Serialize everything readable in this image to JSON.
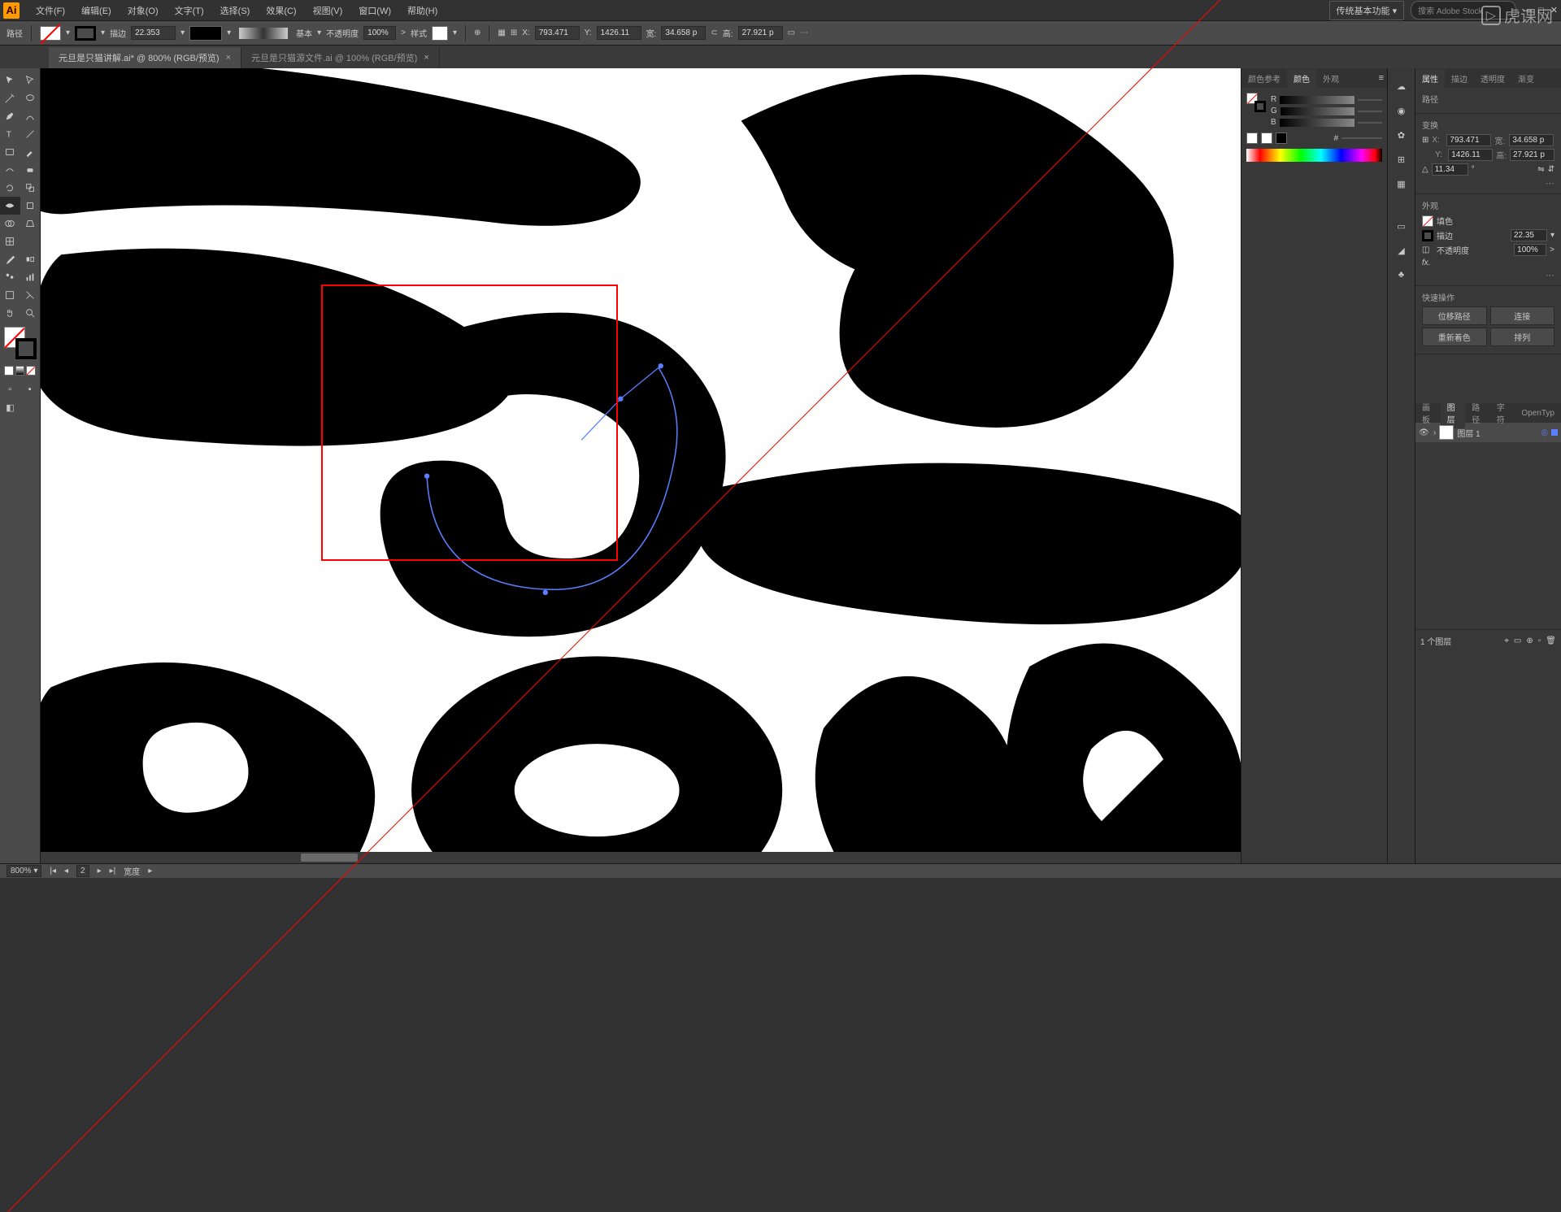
{
  "app": {
    "logo": "Ai"
  },
  "menu": [
    "文件(F)",
    "编辑(E)",
    "对象(O)",
    "文字(T)",
    "选择(S)",
    "效果(C)",
    "视图(V)",
    "窗口(W)",
    "帮助(H)"
  ],
  "workspace": {
    "label": "传统基本功能",
    "search": "搜索 Adobe Stock"
  },
  "control": {
    "mode": "路径",
    "stroke_label": "描边",
    "stroke_width": "22.353",
    "profile": "基本",
    "opacity_label": "不透明度",
    "opacity": "100%",
    "style_label": "样式",
    "x_label": "X:",
    "x": "793.471",
    "y_label": "Y:",
    "y": "1426.11",
    "w_label": "宽:",
    "w": "34.658 p",
    "h_label": "高:",
    "h": "27.921 p"
  },
  "tabs": [
    {
      "label": "元旦是只猫讲解.ai* @ 800% (RGB/预览)",
      "active": true
    },
    {
      "label": "元旦是只猫源文件.ai @ 100% (RGB/预览)",
      "active": false
    }
  ],
  "color_panel": {
    "tabs": [
      "颜色参考",
      "颜色",
      "外观"
    ],
    "active_tab": "颜色",
    "channels": [
      {
        "label": "R",
        "val": ""
      },
      {
        "label": "G",
        "val": ""
      },
      {
        "label": "B",
        "val": ""
      }
    ],
    "hex_label": "#"
  },
  "props_panel": {
    "tabs": [
      "属性",
      "描边",
      "透明度",
      "渐变"
    ],
    "active_tab": "属性",
    "path_label": "路径",
    "transform_title": "变换",
    "x_lbl": "X:",
    "x": "793.471",
    "y_lbl": "Y:",
    "y": "1426.11",
    "w_lbl": "宽:",
    "w": "34.658 p",
    "h_lbl": "高:",
    "h": "27.921 p",
    "angle": "11.34",
    "appearance_title": "外观",
    "fill_label": "填色",
    "stroke_label": "描边",
    "stroke_val": "22.35",
    "opacity_label": "不透明度",
    "opacity_val": "100%",
    "fx": "fx.",
    "quick_title": "快速操作",
    "actions": [
      "位移路径",
      "连接",
      "重新着色",
      "排列"
    ]
  },
  "layers_panel": {
    "tabs": [
      "画板",
      "图层",
      "路径",
      "字符",
      "OpenTyp"
    ],
    "active_tab": "图层",
    "layer_name": "图层 1",
    "footer": "1 个图层"
  },
  "status": {
    "zoom": "800%",
    "artboard": "2",
    "nav_label": "宽度"
  },
  "watermark": "虎课网"
}
